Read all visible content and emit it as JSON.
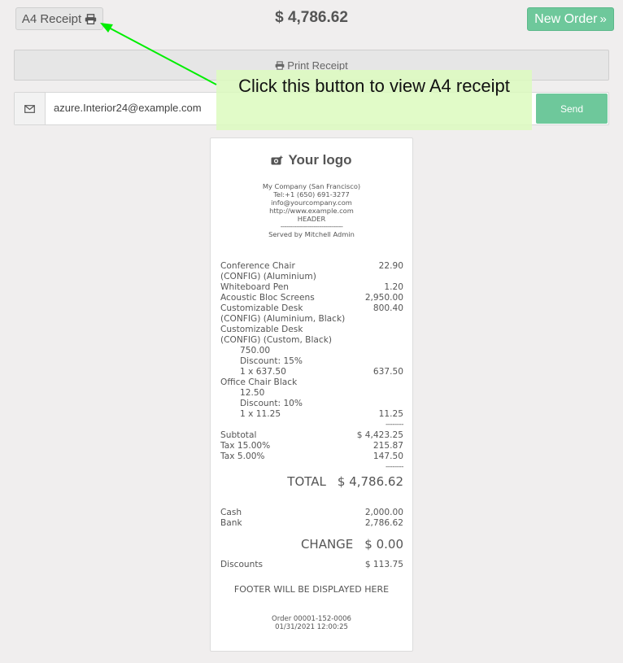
{
  "topbar": {
    "a4_label": "A4 Receipt",
    "total": "$ 4,786.62",
    "new_order_label": "New Order",
    "print_label": "Print Receipt"
  },
  "email": {
    "value": "azure.Interior24@example.com",
    "send_label": "Send"
  },
  "callout": {
    "text": "Click this button to view A4 receipt",
    "color": "#00ee00"
  },
  "receipt": {
    "logo_text": "Your logo",
    "company": {
      "name": "My Company (San Francisco)",
      "tel": "Tel:+1 (650) 691-3277",
      "email": "info@yourcompany.com",
      "website": "http://www.example.com",
      "header": "HEADER",
      "separator": "--------------------------------",
      "served_by": "Served by Mitchell Admin"
    },
    "lines": [
      {
        "label": "Conference Chair",
        "amount": "22.90",
        "indent": false
      },
      {
        "label": "(CONFIG) (Aluminium)",
        "amount": "",
        "indent": false
      },
      {
        "label": "Whiteboard Pen",
        "amount": "1.20",
        "indent": false
      },
      {
        "label": "Acoustic Bloc Screens",
        "amount": "2,950.00",
        "indent": false
      },
      {
        "label": "Customizable Desk",
        "amount": "800.40",
        "indent": false
      },
      {
        "label": "(CONFIG) (Aluminium, Black)",
        "amount": "",
        "indent": false
      },
      {
        "label": "Customizable Desk",
        "amount": "",
        "indent": false
      },
      {
        "label": "(CONFIG) (Custom, Black)",
        "amount": "",
        "indent": false
      },
      {
        "label": "750.00",
        "amount": "",
        "indent": true
      },
      {
        "label": "Discount: 15%",
        "amount": "",
        "indent": true
      },
      {
        "label": "1 x 637.50",
        "amount": "637.50",
        "indent": true
      },
      {
        "label": "Office Chair Black",
        "amount": "",
        "indent": false
      },
      {
        "label": "12.50",
        "amount": "",
        "indent": true
      },
      {
        "label": "Discount: 10%",
        "amount": "",
        "indent": true
      },
      {
        "label": "1 x 11.25",
        "amount": "11.25",
        "indent": true
      }
    ],
    "dash": "--------",
    "subtotal_label": "Subtotal",
    "subtotal": "$ 4,423.25",
    "taxes": [
      {
        "label": "Tax 15.00%",
        "amount": "215.87"
      },
      {
        "label": "Tax 5.00%",
        "amount": "147.50"
      }
    ],
    "total_label": "TOTAL",
    "total": "$ 4,786.62",
    "payments": [
      {
        "label": "Cash",
        "amount": "2,000.00"
      },
      {
        "label": "Bank",
        "amount": "2,786.62"
      }
    ],
    "change_label": "CHANGE",
    "change": "$ 0.00",
    "discounts_label": "Discounts",
    "discounts": "$ 113.75",
    "footer": "FOOTER WILL BE DISPLAYED HERE",
    "order_number": "Order 00001-152-0006",
    "order_date": "01/31/2021 12:00:25"
  }
}
